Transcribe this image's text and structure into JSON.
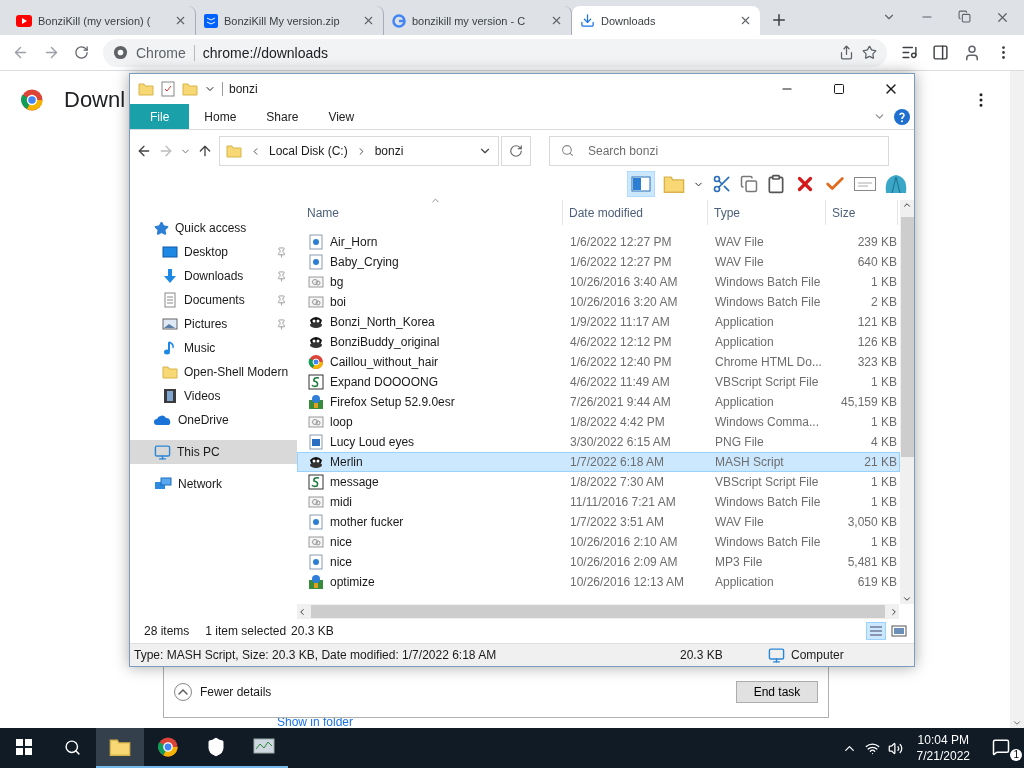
{
  "browser": {
    "tabs": [
      {
        "title": "BonziKill (my version) (",
        "selected": false,
        "kind": "video"
      },
      {
        "title": "BonziKill My version.zip",
        "selected": false,
        "kind": "box"
      },
      {
        "title": "bonzikill my version - C",
        "selected": false,
        "kind": "search"
      },
      {
        "title": "Downloads",
        "selected": true,
        "kind": "download"
      }
    ],
    "site_label": "Chrome",
    "url": "chrome://downloads",
    "page_title": "Downl",
    "link": "Show in folder"
  },
  "explorer": {
    "title": "bonzi",
    "ribbon_tabs": [
      {
        "label": "File",
        "kind": "file"
      },
      {
        "label": "Home",
        "kind": "tab"
      },
      {
        "label": "Share",
        "kind": "tab"
      },
      {
        "label": "View",
        "kind": "tab"
      }
    ],
    "path": [
      "Local Disk (C:)",
      "bonzi"
    ],
    "search": {
      "placeholder": "Search bonzi"
    },
    "nav": [
      {
        "label": "Quick access",
        "kind": "star",
        "selected": false,
        "children": [
          {
            "label": "Desktop",
            "kind": "desktop",
            "pinned": true,
            "selected": false
          },
          {
            "label": "Downloads",
            "kind": "download",
            "pinned": true,
            "selected": false
          },
          {
            "label": "Documents",
            "kind": "document",
            "pinned": true,
            "selected": false
          },
          {
            "label": "Pictures",
            "kind": "picture",
            "pinned": true,
            "selected": false
          },
          {
            "label": "Music",
            "kind": "music",
            "pinned": false,
            "selected": false
          },
          {
            "label": "Open-Shell Modern",
            "kind": "folder",
            "pinned": false,
            "selected": false
          },
          {
            "label": "Videos",
            "kind": "video",
            "pinned": false,
            "selected": false
          }
        ]
      },
      {
        "label": "OneDrive",
        "kind": "cloud",
        "selected": false
      },
      {
        "label": "This PC",
        "kind": "pc",
        "selected": true
      },
      {
        "label": "Network",
        "kind": "network",
        "selected": false
      }
    ],
    "columns": [
      {
        "label": "Name",
        "sorted": true
      },
      {
        "label": "Date modified",
        "sorted": false
      },
      {
        "label": "Type",
        "sorted": false
      },
      {
        "label": "Size",
        "sorted": false
      }
    ],
    "files": [
      {
        "name": "Air_Horn",
        "date": "1/6/2022 12:27 PM",
        "type": "WAV File",
        "size": "239 KB",
        "kind": "audio",
        "selected": false
      },
      {
        "name": "Baby_Crying",
        "date": "1/6/2022 12:27 PM",
        "type": "WAV File",
        "size": "640 KB",
        "kind": "audio",
        "selected": false
      },
      {
        "name": "bg",
        "date": "10/26/2016 3:40 AM",
        "type": "Windows Batch File",
        "size": "1 KB",
        "kind": "batch",
        "selected": false
      },
      {
        "name": "boi",
        "date": "10/26/2016 3:20 AM",
        "type": "Windows Batch File",
        "size": "2 KB",
        "kind": "batch",
        "selected": false
      },
      {
        "name": "Bonzi_North_Korea",
        "date": "1/9/2022 11:17 AM",
        "type": "Application",
        "size": "121 KB",
        "kind": "agent",
        "selected": false
      },
      {
        "name": "BonziBuddy_original",
        "date": "4/6/2022 12:12 PM",
        "type": "Application",
        "size": "126 KB",
        "kind": "agent",
        "selected": false
      },
      {
        "name": "Caillou_without_hair",
        "date": "1/6/2022 12:40 PM",
        "type": "Chrome HTML Do...",
        "size": "323 KB",
        "kind": "web",
        "selected": false
      },
      {
        "name": "Expand DOOOONG",
        "date": "4/6/2022 11:49 AM",
        "type": "VBScript Script File",
        "size": "1 KB",
        "kind": "script",
        "selected": false
      },
      {
        "name": "Firefox Setup 52.9.0esr",
        "date": "7/26/2021 9:44 AM",
        "type": "Application",
        "size": "45,159 KB",
        "kind": "installer",
        "selected": false
      },
      {
        "name": "loop",
        "date": "1/8/2022 4:42 PM",
        "type": "Windows Comma...",
        "size": "1 KB",
        "kind": "batch",
        "selected": false
      },
      {
        "name": "Lucy Loud eyes",
        "date": "3/30/2022 6:15 AM",
        "type": "PNG File",
        "size": "4 KB",
        "kind": "image",
        "selected": false
      },
      {
        "name": "Merlin",
        "date": "1/7/2022 6:18 AM",
        "type": "MASH Script",
        "size": "21 KB",
        "kind": "agent",
        "selected": true
      },
      {
        "name": "message",
        "date": "1/8/2022 7:30 AM",
        "type": "VBScript Script File",
        "size": "1 KB",
        "kind": "script",
        "selected": false
      },
      {
        "name": "midi",
        "date": "11/11/2016 7:21 AM",
        "type": "Windows Batch File",
        "size": "1 KB",
        "kind": "batch",
        "selected": false
      },
      {
        "name": "mother fucker",
        "date": "1/7/2022 3:51 AM",
        "type": "WAV File",
        "size": "3,050 KB",
        "kind": "audio",
        "selected": false
      },
      {
        "name": "nice",
        "date": "10/26/2016 2:10 AM",
        "type": "Windows Batch File",
        "size": "1 KB",
        "kind": "batch",
        "selected": false
      },
      {
        "name": "nice",
        "date": "10/26/2016 2:09 AM",
        "type": "MP3 File",
        "size": "5,481 KB",
        "kind": "audio",
        "selected": false
      },
      {
        "name": "optimize",
        "date": "10/26/2016 12:13 AM",
        "type": "Application",
        "size": "619 KB",
        "kind": "installer",
        "selected": false
      }
    ],
    "status": {
      "count": "28 items",
      "selection": "1 item selected",
      "size": "20.3 KB"
    },
    "details": {
      "summary": "Type: MASH Script, Size: 20.3 KB, Date modified: 1/7/2022 6:18 AM",
      "size": "20.3 KB",
      "location": "Computer"
    }
  },
  "task_manager": {
    "toggle": "Fewer details",
    "button": "End task"
  },
  "taskbar": {
    "apps": [
      {
        "kind": "explorer",
        "selected": true
      },
      {
        "kind": "chrome",
        "selected": false
      },
      {
        "kind": "shield",
        "selected": false
      },
      {
        "kind": "monitor",
        "selected": false
      }
    ],
    "time": "10:04 PM",
    "date": "7/21/2022",
    "notifications": "1"
  }
}
